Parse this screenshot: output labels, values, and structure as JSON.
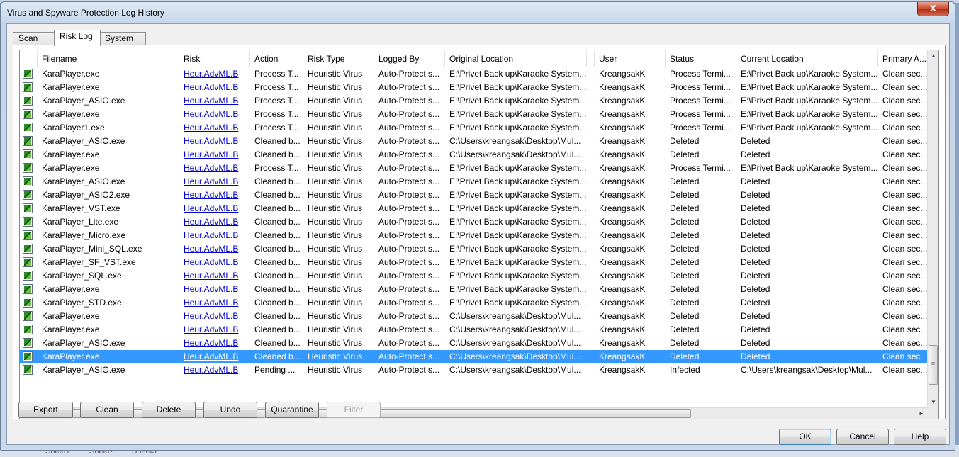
{
  "window": {
    "title": "Virus and Spyware Protection Log History",
    "close_glyph": "X"
  },
  "tabs": [
    {
      "label": "Scan Log",
      "active": false
    },
    {
      "label": "Risk Log",
      "active": true
    },
    {
      "label": "System Log",
      "active": false
    }
  ],
  "columns": [
    "Filename",
    "Risk",
    "Action",
    "Risk Type",
    "Logged By",
    "Original Location",
    "",
    "User",
    "Status",
    "Current Location",
    "Primary A..."
  ],
  "rows": [
    {
      "filename": "KaraPlayer.exe",
      "risk": "Heur.AdvML.B",
      "action": "Process T...",
      "risk_type": "Heuristic Virus",
      "logged_by": "Auto-Protect s...",
      "original_location": "E:\\Privet Back up\\Karaoke System...",
      "user": "KreangsakK",
      "status": "Process Termi...",
      "current_location": "E:\\Privet Back up\\Karaoke System...",
      "primary_action": "Clean sec..."
    },
    {
      "filename": "KaraPlayer.exe",
      "risk": "Heur.AdvML.B",
      "action": "Process T...",
      "risk_type": "Heuristic Virus",
      "logged_by": "Auto-Protect s...",
      "original_location": "E:\\Privet Back up\\Karaoke System...",
      "user": "KreangsakK",
      "status": "Process Termi...",
      "current_location": "E:\\Privet Back up\\Karaoke System...",
      "primary_action": "Clean sec..."
    },
    {
      "filename": "KaraPlayer_ASIO.exe",
      "risk": "Heur.AdvML.B",
      "action": "Process T...",
      "risk_type": "Heuristic Virus",
      "logged_by": "Auto-Protect s...",
      "original_location": "E:\\Privet Back up\\Karaoke System...",
      "user": "KreangsakK",
      "status": "Process Termi...",
      "current_location": "E:\\Privet Back up\\Karaoke System...",
      "primary_action": "Clean sec..."
    },
    {
      "filename": "KaraPlayer.exe",
      "risk": "Heur.AdvML.B",
      "action": "Process T...",
      "risk_type": "Heuristic Virus",
      "logged_by": "Auto-Protect s...",
      "original_location": "E:\\Privet Back up\\Karaoke System...",
      "user": "KreangsakK",
      "status": "Process Termi...",
      "current_location": "E:\\Privet Back up\\Karaoke System...",
      "primary_action": "Clean sec..."
    },
    {
      "filename": "KaraPlayer1.exe",
      "risk": "Heur.AdvML.B",
      "action": "Process T...",
      "risk_type": "Heuristic Virus",
      "logged_by": "Auto-Protect s...",
      "original_location": "E:\\Privet Back up\\Karaoke System...",
      "user": "KreangsakK",
      "status": "Process Termi...",
      "current_location": "E:\\Privet Back up\\Karaoke System...",
      "primary_action": "Clean sec..."
    },
    {
      "filename": "KaraPlayer_ASIO.exe",
      "risk": "Heur.AdvML.B",
      "action": "Cleaned b...",
      "risk_type": "Heuristic Virus",
      "logged_by": "Auto-Protect s...",
      "original_location": "C:\\Users\\kreangsak\\Desktop\\Mul...",
      "user": "KreangsakK",
      "status": "Deleted",
      "current_location": "Deleted",
      "primary_action": "Clean sec..."
    },
    {
      "filename": "KaraPlayer.exe",
      "risk": "Heur.AdvML.B",
      "action": "Cleaned b...",
      "risk_type": "Heuristic Virus",
      "logged_by": "Auto-Protect s...",
      "original_location": "C:\\Users\\kreangsak\\Desktop\\Mul...",
      "user": "KreangsakK",
      "status": "Deleted",
      "current_location": "Deleted",
      "primary_action": "Clean sec..."
    },
    {
      "filename": "KaraPlayer.exe",
      "risk": "Heur.AdvML.B",
      "action": "Process T...",
      "risk_type": "Heuristic Virus",
      "logged_by": "Auto-Protect s...",
      "original_location": "E:\\Privet Back up\\Karaoke System...",
      "user": "KreangsakK",
      "status": "Process Termi...",
      "current_location": "E:\\Privet Back up\\Karaoke System...",
      "primary_action": "Clean sec..."
    },
    {
      "filename": "KaraPlayer_ASIO.exe",
      "risk": "Heur.AdvML.B",
      "action": "Cleaned b...",
      "risk_type": "Heuristic Virus",
      "logged_by": "Auto-Protect s...",
      "original_location": "E:\\Privet Back up\\Karaoke System...",
      "user": "KreangsakK",
      "status": "Deleted",
      "current_location": "Deleted",
      "primary_action": "Clean sec..."
    },
    {
      "filename": "KaraPlayer_ASIO2.exe",
      "risk": "Heur.AdvML.B",
      "action": "Cleaned b...",
      "risk_type": "Heuristic Virus",
      "logged_by": "Auto-Protect s...",
      "original_location": "E:\\Privet Back up\\Karaoke System...",
      "user": "KreangsakK",
      "status": "Deleted",
      "current_location": "Deleted",
      "primary_action": "Clean sec..."
    },
    {
      "filename": "KaraPlayer_VST.exe",
      "risk": "Heur.AdvML.B",
      "action": "Cleaned b...",
      "risk_type": "Heuristic Virus",
      "logged_by": "Auto-Protect s...",
      "original_location": "E:\\Privet Back up\\Karaoke System...",
      "user": "KreangsakK",
      "status": "Deleted",
      "current_location": "Deleted",
      "primary_action": "Clean sec..."
    },
    {
      "filename": "KaraPlayer_Lite.exe",
      "risk": "Heur.AdvML.B",
      "action": "Cleaned b...",
      "risk_type": "Heuristic Virus",
      "logged_by": "Auto-Protect s...",
      "original_location": "E:\\Privet Back up\\Karaoke System...",
      "user": "KreangsakK",
      "status": "Deleted",
      "current_location": "Deleted",
      "primary_action": "Clean sec..."
    },
    {
      "filename": "KaraPlayer_Micro.exe",
      "risk": "Heur.AdvML.B",
      "action": "Cleaned b...",
      "risk_type": "Heuristic Virus",
      "logged_by": "Auto-Protect s...",
      "original_location": "E:\\Privet Back up\\Karaoke System...",
      "user": "KreangsakK",
      "status": "Deleted",
      "current_location": "Deleted",
      "primary_action": "Clean sec..."
    },
    {
      "filename": "KaraPlayer_Mini_SQL.exe",
      "risk": "Heur.AdvML.B",
      "action": "Cleaned b...",
      "risk_type": "Heuristic Virus",
      "logged_by": "Auto-Protect s...",
      "original_location": "E:\\Privet Back up\\Karaoke System...",
      "user": "KreangsakK",
      "status": "Deleted",
      "current_location": "Deleted",
      "primary_action": "Clean sec..."
    },
    {
      "filename": "KaraPlayer_SF_VST.exe",
      "risk": "Heur.AdvML.B",
      "action": "Cleaned b...",
      "risk_type": "Heuristic Virus",
      "logged_by": "Auto-Protect s...",
      "original_location": "E:\\Privet Back up\\Karaoke System...",
      "user": "KreangsakK",
      "status": "Deleted",
      "current_location": "Deleted",
      "primary_action": "Clean sec..."
    },
    {
      "filename": "KaraPlayer_SQL.exe",
      "risk": "Heur.AdvML.B",
      "action": "Cleaned b...",
      "risk_type": "Heuristic Virus",
      "logged_by": "Auto-Protect s...",
      "original_location": "E:\\Privet Back up\\Karaoke System...",
      "user": "KreangsakK",
      "status": "Deleted",
      "current_location": "Deleted",
      "primary_action": "Clean sec..."
    },
    {
      "filename": "KaraPlayer.exe",
      "risk": "Heur.AdvML.B",
      "action": "Cleaned b...",
      "risk_type": "Heuristic Virus",
      "logged_by": "Auto-Protect s...",
      "original_location": "E:\\Privet Back up\\Karaoke System...",
      "user": "KreangsakK",
      "status": "Deleted",
      "current_location": "Deleted",
      "primary_action": "Clean sec..."
    },
    {
      "filename": "KaraPlayer_STD.exe",
      "risk": "Heur.AdvML.B",
      "action": "Cleaned b...",
      "risk_type": "Heuristic Virus",
      "logged_by": "Auto-Protect s...",
      "original_location": "E:\\Privet Back up\\Karaoke System...",
      "user": "KreangsakK",
      "status": "Deleted",
      "current_location": "Deleted",
      "primary_action": "Clean sec..."
    },
    {
      "filename": "KaraPlayer.exe",
      "risk": "Heur.AdvML.B",
      "action": "Cleaned b...",
      "risk_type": "Heuristic Virus",
      "logged_by": "Auto-Protect s...",
      "original_location": "C:\\Users\\kreangsak\\Desktop\\Mul...",
      "user": "KreangsakK",
      "status": "Deleted",
      "current_location": "Deleted",
      "primary_action": "Clean sec..."
    },
    {
      "filename": "KaraPlayer.exe",
      "risk": "Heur.AdvML.B",
      "action": "Cleaned b...",
      "risk_type": "Heuristic Virus",
      "logged_by": "Auto-Protect s...",
      "original_location": "C:\\Users\\kreangsak\\Desktop\\Mul...",
      "user": "KreangsakK",
      "status": "Deleted",
      "current_location": "Deleted",
      "primary_action": "Clean sec..."
    },
    {
      "filename": "KaraPlayer_ASIO.exe",
      "risk": "Heur.AdvML.B",
      "action": "Cleaned b...",
      "risk_type": "Heuristic Virus",
      "logged_by": "Auto-Protect s...",
      "original_location": "C:\\Users\\kreangsak\\Desktop\\Mul...",
      "user": "KreangsakK",
      "status": "Deleted",
      "current_location": "Deleted",
      "primary_action": "Clean sec..."
    },
    {
      "filename": "KaraPlayer.exe",
      "risk": "Heur.AdvML.B",
      "action": "Cleaned b...",
      "risk_type": "Heuristic Virus",
      "logged_by": "Auto-Protect s...",
      "original_location": "C:\\Users\\kreangsak\\Desktop\\Mul...",
      "user": "KreangsakK",
      "status": "Deleted",
      "current_location": "Deleted",
      "primary_action": "Clean sec...",
      "selected": true
    },
    {
      "filename": "KaraPlayer_ASIO.exe",
      "risk": "Heur.AdvML.B",
      "action": "Pending ...",
      "risk_type": "Heuristic Virus",
      "logged_by": "Auto-Protect s...",
      "original_location": "C:\\Users\\kreangsak\\Desktop\\Mul...",
      "user": "KreangsakK",
      "status": "Infected",
      "current_location": "C:\\Users\\kreangsak\\Desktop\\Mul...",
      "primary_action": "Clean sec..."
    }
  ],
  "scrollbars": {
    "up": "▲",
    "down": "▼",
    "left": "◄",
    "right": "►",
    "grip_v": "≡",
    "grip_h": "|||"
  },
  "actions": {
    "export": "Export",
    "clean": "Clean",
    "delete": "Delete",
    "undo": "Undo",
    "quarantine": "Quarantine",
    "filter": "Filter"
  },
  "dialog_buttons": {
    "ok": "OK",
    "cancel": "Cancel",
    "help": "Help"
  },
  "background_sheets": [
    "Sheet1",
    "Sheet2",
    "Sheet3"
  ],
  "colors": {
    "selection": "#3399ff",
    "link": "#0000cc",
    "close_button": "#c8452c"
  }
}
